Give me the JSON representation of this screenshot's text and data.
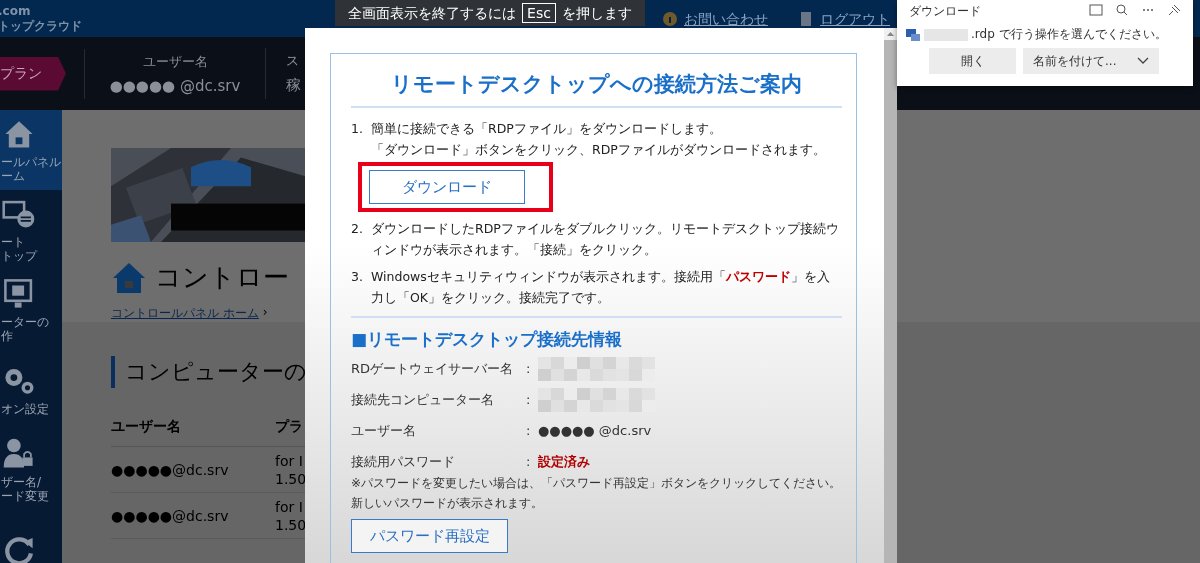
{
  "fullscreen_notice": {
    "before": "全画面表示を終了するには",
    "key": "Esc",
    "after": "を押します"
  },
  "header": {
    "logo_lines": [
      ".com",
      "トップクラウド"
    ],
    "nav": [
      {
        "label": "お問い合わせ",
        "kind": "info"
      },
      {
        "label": "ログアウト",
        "kind": "door"
      }
    ]
  },
  "info_bar": {
    "plan": "プラン",
    "fields": [
      {
        "label": "ユーザー名",
        "value": "●●●●● @dc.srv"
      },
      {
        "label": "ス",
        "value": "稼"
      }
    ]
  },
  "sidebar": {
    "items": [
      {
        "kind": "home",
        "lines": [
          "ールパネル",
          "ーム"
        ],
        "selected": true
      },
      {
        "kind": "remote",
        "lines": [
          "ート",
          "トップ"
        ],
        "selected": false
      },
      {
        "kind": "computer",
        "lines": [
          "ーターの",
          "作"
        ],
        "selected": false
      },
      {
        "kind": "gears",
        "lines": [
          "オン設定"
        ],
        "selected": false
      },
      {
        "kind": "user-lock",
        "lines": [
          "ザー名/",
          "ード変更"
        ],
        "selected": false
      },
      {
        "kind": "refresh",
        "selected": false
      }
    ]
  },
  "content": {
    "title": "コントロー",
    "breadcrumb": {
      "link": "コントロールパネル ホーム",
      "separator": "›"
    },
    "section_title": "コンピューターの",
    "table": {
      "columns": [
        "ユーザー名",
        "プラ"
      ],
      "rows": [
        {
          "user": "●●●●●@dc.srv",
          "plan_lines": [
            "for I",
            "1.50"
          ]
        },
        {
          "user": "●●●●●@dc.srv",
          "plan_lines": [
            "for I",
            "1.50"
          ]
        }
      ]
    }
  },
  "modal": {
    "title": "リモートデスクトップへの接続方法ご案内",
    "steps": [
      {
        "number": "1.",
        "lines": [
          "簡単に接続できる「RDPファイル」をダウンロードします。",
          "「ダウンロード」ボタンをクリック、RDPファイルがダウンロードされます。"
        ],
        "button": {
          "label": "ダウンロード",
          "highlighted": true
        }
      },
      {
        "number": "2.",
        "lines": [
          "ダウンロードしたRDPファイルをダブルクリック。リモートデスクトップ接続ウィンドウが表示されます。「接続」をクリック。"
        ]
      },
      {
        "number": "3.",
        "lines": [
          "Windowsセキュリティウィンドウが表示されます。接続用「**パスワード**」を入力し「OK」をクリック。接続完了です。"
        ]
      }
    ],
    "info_title": "■リモートデスクトップ接続先情報",
    "info_rows": [
      {
        "label": "RDゲートウェイサーバー名",
        "colon": ":",
        "kind": "redacted"
      },
      {
        "label": "接続先コンピューター名",
        "colon": ":",
        "kind": "redacted"
      },
      {
        "label": "ユーザー名",
        "colon": ":",
        "kind": "text",
        "value": "●●●●● @dc.srv"
      },
      {
        "label": "接続用パスワード",
        "colon": ":",
        "kind": "status",
        "value": "設定済み"
      }
    ],
    "note": "※パスワードを変更したい場合は、「パスワード再設定」ボタンをクリックしてください。新しいパスワードが表示されます。",
    "reset_button": "パスワード再設定"
  },
  "download_panel": {
    "title": "ダウンロード",
    "message": ".rdp で行う操作を選んでください。",
    "buttons": [
      {
        "label": "開く",
        "kind": "plain"
      },
      {
        "label": "名前を付けて...",
        "kind": "dropdown"
      }
    ]
  }
}
